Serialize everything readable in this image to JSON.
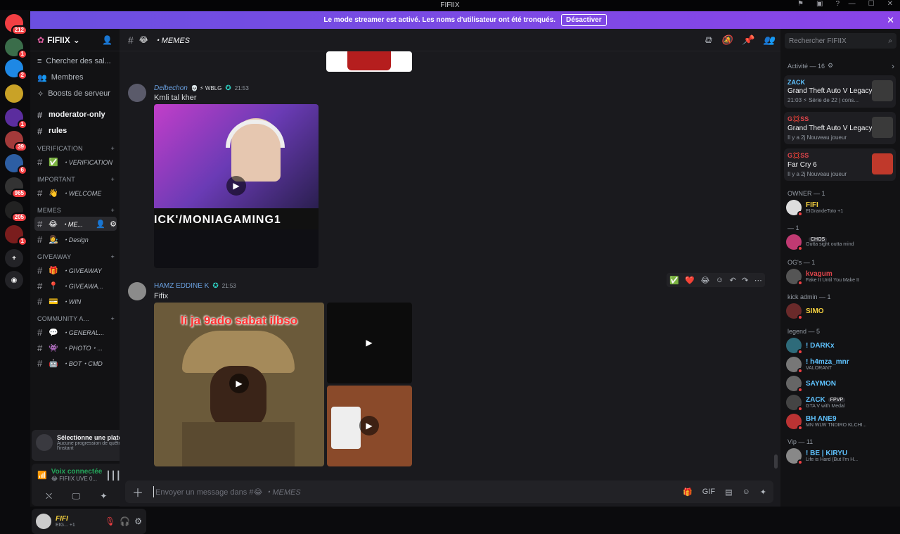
{
  "window": {
    "title": "FIFIIX"
  },
  "banner": {
    "text": "Le mode streamer est activé. Les noms d'utilisateur ont été tronqués.",
    "button": "Désactiver"
  },
  "guilds": [
    {
      "badge": "212",
      "color": "#f23f43"
    },
    {
      "badge": "1",
      "color": "#3a6d4a"
    },
    {
      "badge": "2",
      "color": "#1e88e5"
    },
    {
      "badge": "",
      "color": "#c9a227"
    },
    {
      "badge": "1",
      "color": "#5b2d9e"
    },
    {
      "badge": "39",
      "color": "#a33a3a"
    },
    {
      "badge": "6",
      "color": "#2d5ea3"
    },
    {
      "badge": "965",
      "color": "#333"
    },
    {
      "badge": "205",
      "color": "#222"
    },
    {
      "badge": "1",
      "color": "#7a1d1d"
    }
  ],
  "server": {
    "name": "FIFIIX"
  },
  "sidebar": {
    "top": [
      "Chercher des sal...",
      "Membres",
      "Boosts de serveur"
    ],
    "channels_top": [
      {
        "name": "moderator-only"
      },
      {
        "name": "rules"
      }
    ],
    "categories": [
      {
        "name": "VERIFICATION",
        "channels": [
          {
            "emoji": "✅",
            "name": "・VERIFICATION"
          }
        ]
      },
      {
        "name": "IMPORTANT",
        "channels": [
          {
            "emoji": "👋",
            "name": "・WELCOME"
          }
        ]
      },
      {
        "name": "MEMES",
        "channels": [
          {
            "emoji": "😂",
            "name": "・ME..."
          },
          {
            "emoji": "👩‍🎨",
            "name": "・Design"
          }
        ]
      },
      {
        "name": "GIVEAWAY",
        "channels": [
          {
            "emoji": "🎁",
            "name": "・GIVEAWAY"
          },
          {
            "emoji": "📍",
            "name": "・GIVEAWA..."
          },
          {
            "emoji": "💳",
            "name": "・WIN"
          }
        ]
      },
      {
        "name": "COMMUNITY A...",
        "channels": [
          {
            "emoji": "💬",
            "name": "・GENERAL..."
          },
          {
            "emoji": "👾",
            "name": "・PHOTO・..."
          },
          {
            "emoji": "🤖",
            "name": "・BOT・CMD"
          }
        ]
      }
    ],
    "quest": {
      "title": "Sélectionne une plateforme",
      "subtitle": "Aucune progression de quête pour l'instant"
    },
    "voice": {
      "status": "Voix connectée",
      "channel": "😂 FIFIIX UVE 0..."
    },
    "user": {
      "name": "FIFI",
      "status": "EIG... +1"
    }
  },
  "channel": {
    "emoji": "😂",
    "name": "・MEMES"
  },
  "messages": [
    {
      "author": "Delbechon",
      "badges": "💀 ⚡ WBLG",
      "time": "21:53",
      "text": "Kmli tal kher",
      "overlay": "ICK'/MONIAGAMING1"
    },
    {
      "author": "HAMZ EDDINE K",
      "time": "21:53",
      "text": "Fifix",
      "caption": "li ja 9ado sabat ilbso"
    }
  ],
  "toolbar": {
    "icons": [
      "✅",
      "❤️",
      "😂",
      "☺",
      "↶",
      "↷",
      "⋯"
    ]
  },
  "composer": {
    "placeholder_prefix": "Envoyer un message dans #",
    "placeholder_channel": "😂 ・MEMES"
  },
  "members": {
    "search": "Rechercher FIFIIX",
    "activity": {
      "title": "Activité — 16",
      "cards": [
        {
          "user": "ZACK",
          "game": "Grand Theft Auto V Legacy",
          "sub": "21:03 ⚡ Série de 22 | cons...",
          "art": "#3a3a3a",
          "userColor": "#5fc3ff"
        },
        {
          "user": "G💢SS",
          "game": "Grand Theft Auto V Legacy",
          "sub": "Il y a 2j  Nouveau joueur",
          "art": "#3a3a3a",
          "userColor": "#e0454b"
        },
        {
          "user": "G💢SS",
          "game": "Far Cry 6",
          "sub": "Il y a 2j  Nouveau joueur",
          "art": "#c0392b",
          "userColor": "#e0454b"
        }
      ]
    },
    "groups": [
      {
        "title": "OWNER — 1",
        "members": [
          {
            "name": "FIFI",
            "status": "EIGrandeToto +1",
            "color": "#f4d03f",
            "av": "#ddd"
          }
        ]
      },
      {
        "title": "— 1",
        "members": [
          {
            "name": "",
            "status": "Outta sight outta mind",
            "color": "#fff",
            "av": "#c03a72",
            "tag": "CHOS"
          }
        ]
      },
      {
        "title": "OG's — 1",
        "members": [
          {
            "name": "kvagum",
            "status": "Fake It Until You Make It",
            "color": "#e0454b",
            "av": "#555"
          }
        ]
      },
      {
        "title": "kick admin — 1",
        "members": [
          {
            "name": "SIMO",
            "status": "",
            "color": "#f4d03f",
            "av": "#6a2a2a"
          }
        ]
      },
      {
        "title": "legend — 5",
        "members": [
          {
            "name": "! DARKx",
            "status": "",
            "color": "#5fc3ff",
            "av": "#2e6b7a"
          },
          {
            "name": "! h4mza_mnr",
            "status": "VALORANT",
            "color": "#5fc3ff",
            "av": "#777"
          },
          {
            "name": "SAYMON",
            "status": "",
            "color": "#5fc3ff",
            "av": "#666"
          },
          {
            "name": "ZACK",
            "status": "GTA V with Medal",
            "color": "#5fc3ff",
            "av": "#444",
            "tag": "FPVP"
          },
          {
            "name": "BH ANE9",
            "status": "MN WLW TNDIRO KLCHI...",
            "color": "#5fc3ff",
            "av": "#b33"
          }
        ]
      },
      {
        "title": "Vip — 11",
        "members": [
          {
            "name": "! BE | KIRYU",
            "status": "Life is Hard (But I'm H...",
            "color": "#5fc3ff",
            "av": "#888"
          }
        ]
      }
    ]
  }
}
